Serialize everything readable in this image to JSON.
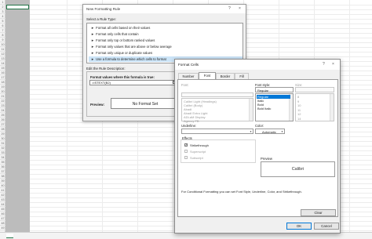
{
  "sheet": {
    "row_numbers": [
      "1",
      "2",
      "3",
      "4",
      "5",
      "6",
      "7",
      "8",
      "9",
      "10",
      "11",
      "12",
      "13",
      "14",
      "15",
      "16",
      "17",
      "18",
      "19",
      "20",
      "21",
      "22",
      "23",
      "24",
      "25",
      "26",
      "27",
      "28",
      "29",
      "30",
      "31",
      "32",
      "33",
      "34",
      "35",
      "36",
      "37",
      "38",
      "39",
      "40",
      "41",
      "42",
      "43",
      "44",
      "45",
      "46",
      "47",
      "48",
      "49"
    ]
  },
  "new_rule_dialog": {
    "title": "New Formatting Rule",
    "help_glyph": "?",
    "close_glyph": "×",
    "select_rule_type_label": "Select a Rule Type:",
    "rule_types": [
      "Format all cells based on their values",
      "Format only cells that contain",
      "Format only top or bottom ranked values",
      "Format only values that are above or below average",
      "Format only unique or duplicate values",
      "Use a formula to determine which cells to format"
    ],
    "selected_rule_index": 5,
    "edit_description_label": "Edit the Rule Description:",
    "formula_label": "Format values where this formula is true:",
    "formula_value": "=ISTEXT(B2)",
    "preview_label": "Preview:",
    "preview_text": "No Format Set"
  },
  "format_cells_dialog": {
    "title": "Format Cells",
    "help_glyph": "?",
    "close_glyph": "×",
    "tabs": [
      "Number",
      "Font",
      "Border",
      "Fill"
    ],
    "active_tab": "Font",
    "font_label": "Font:",
    "font_list": [
      "Calibri Light (Headings)",
      "Calibri (Body)",
      "Abadi",
      "Abadi Extra Light",
      "ADLaM Display",
      "Agency FB"
    ],
    "font_style_label": "Font style:",
    "font_style_value": "Regular",
    "font_styles": [
      "Regular",
      "Italic",
      "Bold",
      "Bold Italic"
    ],
    "selected_style_index": 0,
    "size_label": "Size:",
    "sizes": [
      "8",
      "9",
      "10",
      "11",
      "12",
      "14"
    ],
    "underline_label": "Underline:",
    "color_label": "Color:",
    "color_value": "Automatic",
    "effects_label": "Effects",
    "effects": [
      {
        "label": "Strikethrough",
        "checked": true,
        "enabled": true
      },
      {
        "label": "Superscript",
        "checked": false,
        "enabled": false
      },
      {
        "label": "Subscript",
        "checked": false,
        "enabled": false
      }
    ],
    "preview_label": "Preview",
    "preview_text": "Calibri",
    "info_text": "For Conditional Formatting you can set Font Style, Underline, Color, and Strikethrough.",
    "clear_button": "Clear",
    "ok_button": "OK",
    "cancel_button": "Cancel"
  }
}
